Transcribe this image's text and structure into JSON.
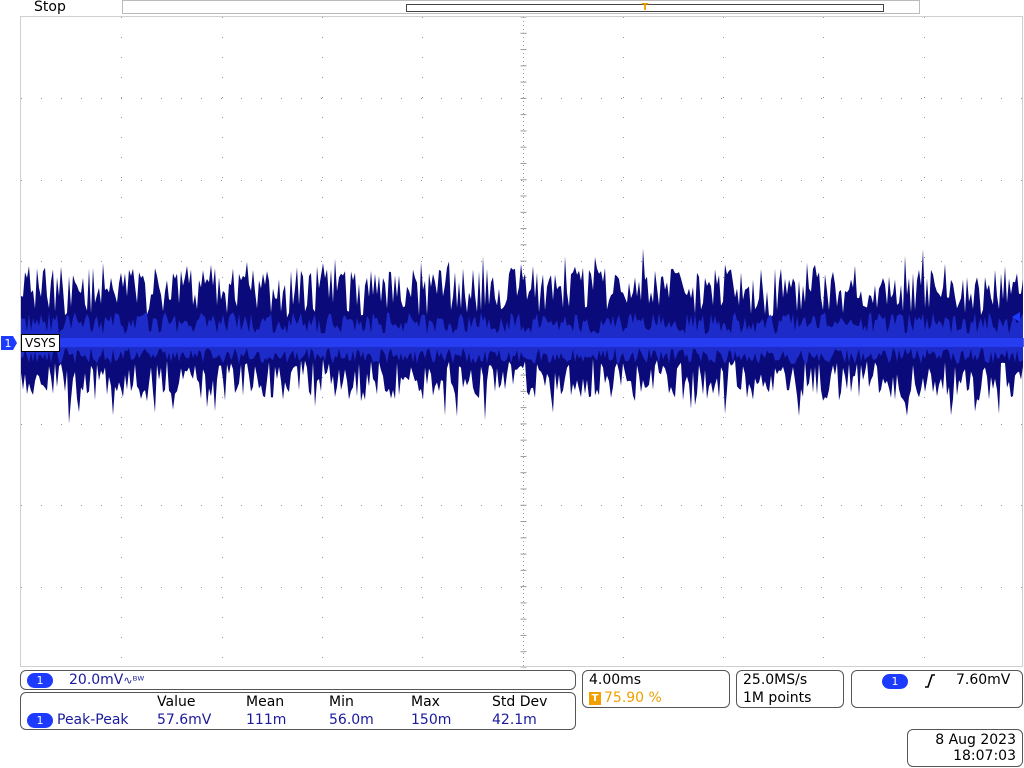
{
  "status": {
    "run_state": "Stop"
  },
  "channel": {
    "number": "1",
    "label": "VSYS",
    "color": "#1d3bff"
  },
  "vertical": {
    "scale": "20.0mV",
    "bw_symbol": "∿ᴮᵂ"
  },
  "measurement": {
    "headers": [
      "Value",
      "Mean",
      "Min",
      "Max",
      "Std Dev"
    ],
    "name": "Peak-Peak",
    "values": [
      "57.6mV",
      "111m",
      "56.0m",
      "150m",
      "42.1m"
    ]
  },
  "timebase": {
    "scale": "4.00ms",
    "trigger_position": "75.90 %",
    "trigger_badge": "T"
  },
  "acquisition": {
    "sample_rate": "25.0MS/s",
    "record_length": "1M points"
  },
  "trigger": {
    "channel": "1",
    "slope": "rising",
    "level": "7.60mV"
  },
  "datetime": {
    "date": "8 Aug 2023",
    "time": "18:07:03"
  },
  "colors": {
    "trace_dark": "#0a0a7a",
    "trace_mid": "#1f2fd0",
    "trace_bright": "#2a44ff",
    "trigger": "#f0a000",
    "grid": "#999999"
  }
}
